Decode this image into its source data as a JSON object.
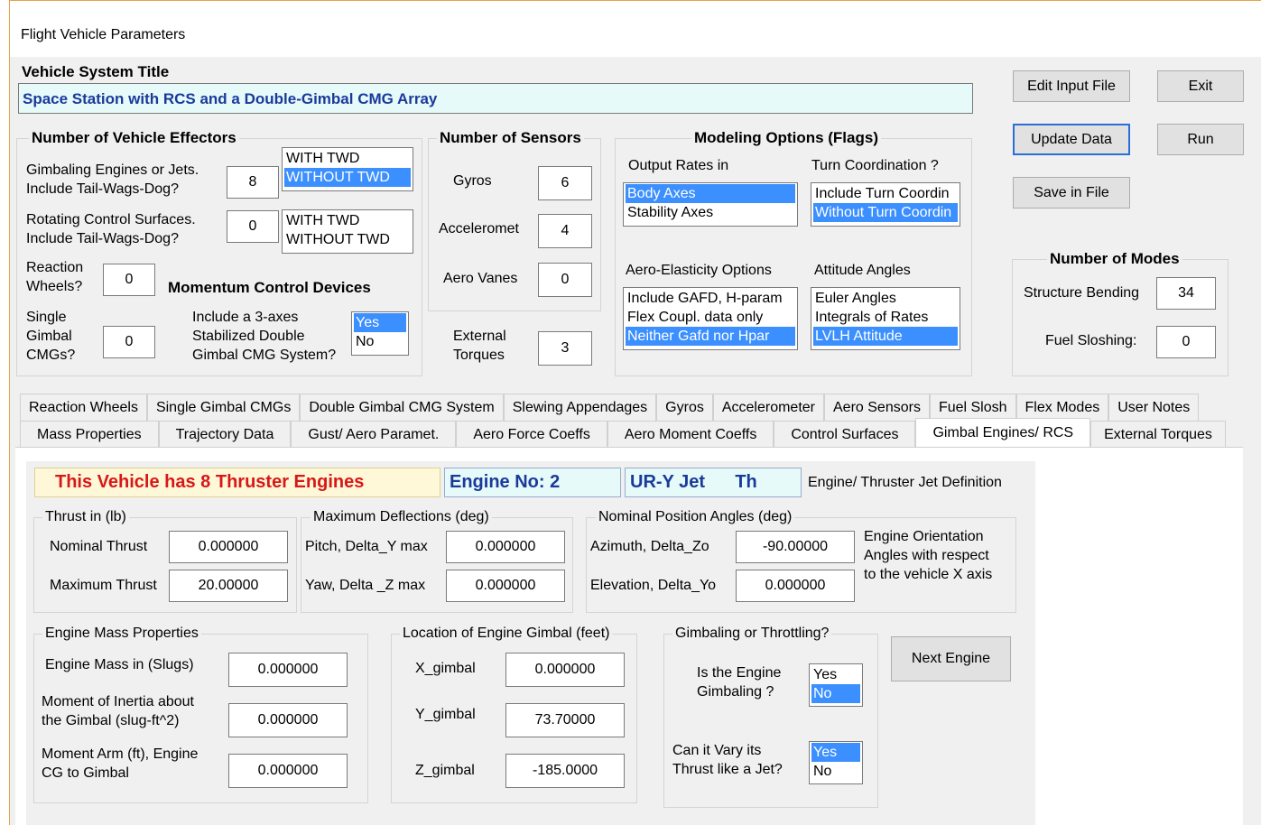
{
  "window": {
    "title": "Flight Vehicle Parameters"
  },
  "vehicle": {
    "title_label": "Vehicle System Title",
    "title_value": "Space Station with RCS and a Double-Gimbal CMG Array"
  },
  "buttons": {
    "edit_input": "Edit Input File",
    "exit": "Exit",
    "update": "Update Data",
    "run": "Run",
    "save": "Save in File",
    "next_engine": "Next Engine"
  },
  "effectors": {
    "heading": "Number of Vehicle Effectors",
    "gimbal_label1": "Gimbaling Engines or Jets.",
    "gimbal_label2": "Include Tail-Wags-Dog?",
    "gimbal_value": "8",
    "gimbal_twd": [
      "WITH TWD",
      "WITHOUT TWD"
    ],
    "rot_label1": "Rotating Control Surfaces.",
    "rot_label2": "Include Tail-Wags-Dog?",
    "rot_value": "0",
    "rot_twd": [
      "WITH TWD",
      "WITHOUT TWD"
    ],
    "rw_label1": "Reaction",
    "rw_label2": "Wheels?",
    "rw_value": "0",
    "mcd_heading": "Momentum Control Devices",
    "sg_label1": "Single",
    "sg_label2": "Gimbal",
    "sg_label3": "CMGs?",
    "sg_value": "0",
    "dg_label1": "Include a 3-axes",
    "dg_label2": "Stabilized Double",
    "dg_label3": "Gimbal CMG System?",
    "dg_options": [
      "Yes",
      "No"
    ]
  },
  "sensors": {
    "heading": "Number of Sensors",
    "gyros_label": "Gyros",
    "gyros_value": "6",
    "accel_label": "Acceleromet",
    "accel_value": "4",
    "vanes_label": "Aero Vanes",
    "vanes_value": "0",
    "ext_label1": "External",
    "ext_label2": "Torques",
    "ext_value": "3"
  },
  "modeling": {
    "heading": "Modeling Options (Flags)",
    "output_label": "Output Rates in",
    "output_options": [
      "Body Axes",
      "Stability Axes"
    ],
    "turn_label": "Turn Coordination ?",
    "turn_options": [
      "Include Turn Coordin",
      "Without Turn Coordin"
    ],
    "aero_label": "Aero-Elasticity Options",
    "aero_options": [
      "Include GAFD, H-param",
      "Flex Coupl. data only",
      "Neither Gafd nor Hpar"
    ],
    "att_label": "Attitude Angles",
    "att_options": [
      "Euler Angles",
      "Integrals of Rates",
      "LVLH Attitude"
    ]
  },
  "modes": {
    "heading": "Number of Modes",
    "struct_label": "Structure Bending",
    "struct_value": "34",
    "fuel_label": "Fuel Sloshing:",
    "fuel_value": "0"
  },
  "tabs_row1": [
    "Reaction Wheels",
    "Single Gimbal CMGs",
    "Double Gimbal CMG System",
    "Slewing Appendages",
    "Gyros",
    "Accelerometer",
    "Aero Sensors",
    "Fuel Slosh",
    "Flex Modes",
    "User Notes"
  ],
  "tabs_row2": [
    "Mass Properties",
    "Trajectory Data",
    "Gust/ Aero Paramet.",
    "Aero Force Coeffs",
    "Aero Moment Coeffs",
    "Control Surfaces",
    "Gimbal Engines/ RCS",
    "External Torques"
  ],
  "engine": {
    "count_text": "This Vehicle has   8 Thruster Engines",
    "engine_no": "Engine No:  2",
    "jet_name": "UR-Y Jet      Th",
    "def_label": "Engine/ Thruster Jet Definition",
    "thrust_group": "Thrust in (lb)",
    "nominal_label": "Nominal Thrust",
    "nominal_value": "0.000000",
    "max_label": "Maximum Thrust",
    "max_value": "20.00000",
    "defl_group": "Maximum Deflections (deg)",
    "pitch_label": "Pitch, Delta_Y max",
    "pitch_value": "0.000000",
    "yaw_label": "Yaw, Delta _Z max",
    "yaw_value": "0.000000",
    "pos_group": "Nominal Position Angles (deg)",
    "az_label": "Azimuth, Delta_Zo",
    "az_value": "-90.00000",
    "el_label": "Elevation, Delta_Yo",
    "el_value": "0.000000",
    "orient_text1": "Engine Orientation",
    "orient_text2": "Angles with respect",
    "orient_text3": "to the vehicle  X axis",
    "mass_group": "Engine Mass Properties",
    "mass_label": "Engine Mass in (Slugs)",
    "mass_value": "0.000000",
    "inertia_label1": "Moment of Inertia about",
    "inertia_label2": "the Gimbal (slug-ft^2)",
    "inertia_value": "0.000000",
    "arm_label1": "Moment Arm (ft), Engine",
    "arm_label2": "CG to Gimbal",
    "arm_value": "0.000000",
    "loc_group": "Location of Engine Gimbal (feet)",
    "x_label": "X_gimbal",
    "x_value": "0.000000",
    "y_label": "Y_gimbal",
    "y_value": "73.70000",
    "z_label": "Z_gimbal",
    "z_value": "-185.0000",
    "gt_group": "Gimbaling or Throttling?",
    "gimb_label1": "Is the Engine",
    "gimb_label2": "Gimbaling ?",
    "gimb_options": [
      "Yes",
      "No"
    ],
    "vary_label1": "Can it Vary its",
    "vary_label2": "Thrust like a Jet?",
    "vary_options": [
      "Yes",
      "No"
    ]
  }
}
